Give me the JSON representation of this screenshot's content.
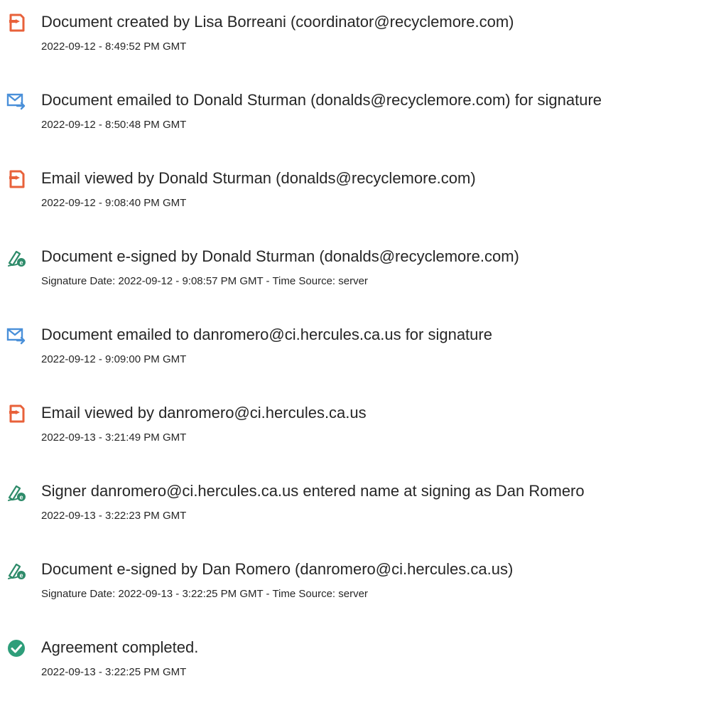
{
  "colors": {
    "document_icon": "#e8613a",
    "email_icon": "#4a90d9",
    "esign_icon": "#2e8b6a",
    "complete_icon": "#2e9e7a",
    "text": "#262626"
  },
  "events": [
    {
      "icon": "document-icon",
      "title": "Document created by Lisa Borreani (coordinator@recyclemore.com)",
      "detail": "2022-09-12 - 8:49:52 PM GMT"
    },
    {
      "icon": "email-icon",
      "title": "Document emailed to Donald Sturman (donalds@recyclemore.com) for signature",
      "detail": "2022-09-12 - 8:50:48 PM GMT"
    },
    {
      "icon": "document-icon",
      "title": "Email viewed by Donald Sturman (donalds@recyclemore.com)",
      "detail": "2022-09-12 - 9:08:40 PM GMT"
    },
    {
      "icon": "esign-icon",
      "title": "Document e-signed by Donald Sturman (donalds@recyclemore.com)",
      "detail": "Signature Date: 2022-09-12 - 9:08:57 PM GMT - Time Source: server"
    },
    {
      "icon": "email-icon",
      "title": "Document emailed to danromero@ci.hercules.ca.us for signature",
      "detail": "2022-09-12 - 9:09:00 PM GMT"
    },
    {
      "icon": "document-icon",
      "title": "Email viewed by danromero@ci.hercules.ca.us",
      "detail": "2022-09-13 - 3:21:49 PM GMT"
    },
    {
      "icon": "esign-icon",
      "title": "Signer danromero@ci.hercules.ca.us entered name at signing as Dan Romero",
      "detail": "2022-09-13 - 3:22:23 PM GMT"
    },
    {
      "icon": "esign-icon",
      "title": "Document e-signed by Dan Romero (danromero@ci.hercules.ca.us)",
      "detail": "Signature Date: 2022-09-13 - 3:22:25 PM GMT - Time Source: server"
    },
    {
      "icon": "check-circle-icon",
      "title": "Agreement completed.",
      "detail": "2022-09-13 - 3:22:25 PM GMT"
    }
  ]
}
